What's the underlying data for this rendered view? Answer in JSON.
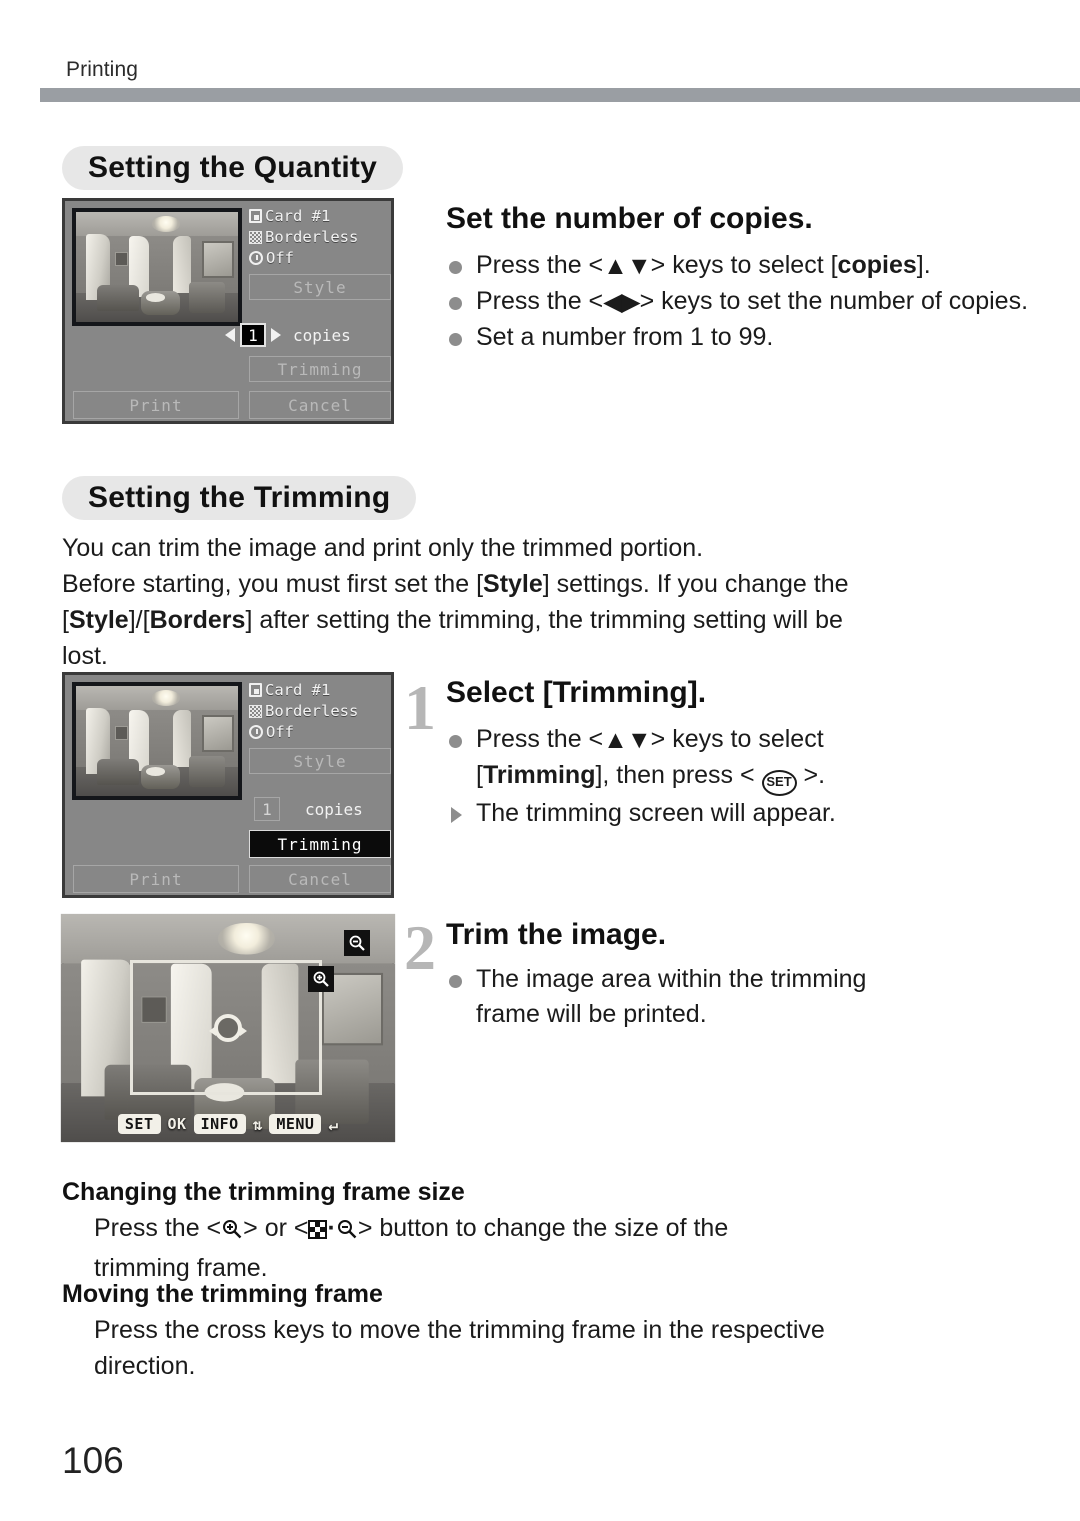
{
  "running_head": "Printing",
  "page_number": "106",
  "sections": [
    {
      "id": "quantity",
      "heading": "Setting the Quantity",
      "step_title": "Set the number of copies.",
      "bullets": [
        {
          "pre": "Press the <",
          "keys": "updown",
          "post": "> keys to select [",
          "bold": "copies",
          "tail": "]."
        },
        {
          "pre": "Press the <",
          "keys": "leftright",
          "post": "> keys to set the number of copies."
        },
        {
          "pre": "Set a number from 1 to 99."
        }
      ]
    },
    {
      "id": "trimming",
      "heading": "Setting the Trimming",
      "intro_line1": "You can trim the image and print only the trimmed portion.",
      "intro_line2_a": "Before starting, you must first set the [",
      "intro_line2_b": "Style",
      "intro_line2_c": "] settings. If you change the",
      "intro_line3_a": "Style",
      "intro_line3_b": "Borders",
      "intro_line3_c": "] after setting the trimming, the trimming setting will be",
      "intro_line4": "lost."
    }
  ],
  "steps": [
    {
      "number": "1",
      "title": "Select [Trimming].",
      "bullet_a_pre": "Press the <",
      "bullet_a_post": "> keys to select",
      "bullet_a_line2_a": "[",
      "bullet_a_line2_b": "Trimming",
      "bullet_a_line2_c": "], then press <",
      "bullet_a_line2_d": ">.",
      "set_key_label": "SET",
      "arrow_note": "The trimming screen will appear."
    },
    {
      "number": "2",
      "title": "Trim the image.",
      "bullet_line1": "The image area within the trimming",
      "bullet_line2": "frame will be printed."
    }
  ],
  "notes": [
    {
      "heading": "Changing the trimming frame size",
      "line1_a": "Press the <",
      "line1_b": "> or <",
      "line1_c": "> button to change the size of the",
      "line2": "trimming frame."
    },
    {
      "heading": "Moving the trimming frame",
      "line1": "Press the cross keys to move the trimming frame in the respective",
      "line2": "direction."
    }
  ],
  "lcd_quantity": {
    "card_label": "Card #1",
    "borderless_label": "Borderless",
    "off_label": "Off",
    "style_label": "Style",
    "copies_value": "1",
    "copies_label": "copies",
    "trimming_label": "Trimming",
    "print_label": "Print",
    "cancel_label": "Cancel",
    "selected": "copies"
  },
  "lcd_trimming_select": {
    "card_label": "Card #1",
    "borderless_label": "Borderless",
    "off_label": "Off",
    "style_label": "Style",
    "copies_value": "1",
    "copies_label": "copies",
    "trimming_label": "Trimming",
    "print_label": "Print",
    "cancel_label": "Cancel",
    "selected": "Trimming"
  },
  "lcd_trim_screen": {
    "guide_set": "SET",
    "guide_ok": "OK",
    "guide_info": "INFO",
    "guide_rotate_icon": "rotate-icon",
    "guide_menu": "MENU",
    "guide_back_icon": "back-arrow-icon",
    "magnify_in_icon": "magnify-plus-icon",
    "magnify_out_icon": "magnify-minus-icon"
  },
  "colors": {
    "rule": "#9a9ea3",
    "heading_pill": "#e7e7e7",
    "bullet": "#8d8d8d",
    "step_number": "#b6b6b6",
    "lcd_background": "#878787",
    "lcd_selected": "#0b0b0b"
  }
}
